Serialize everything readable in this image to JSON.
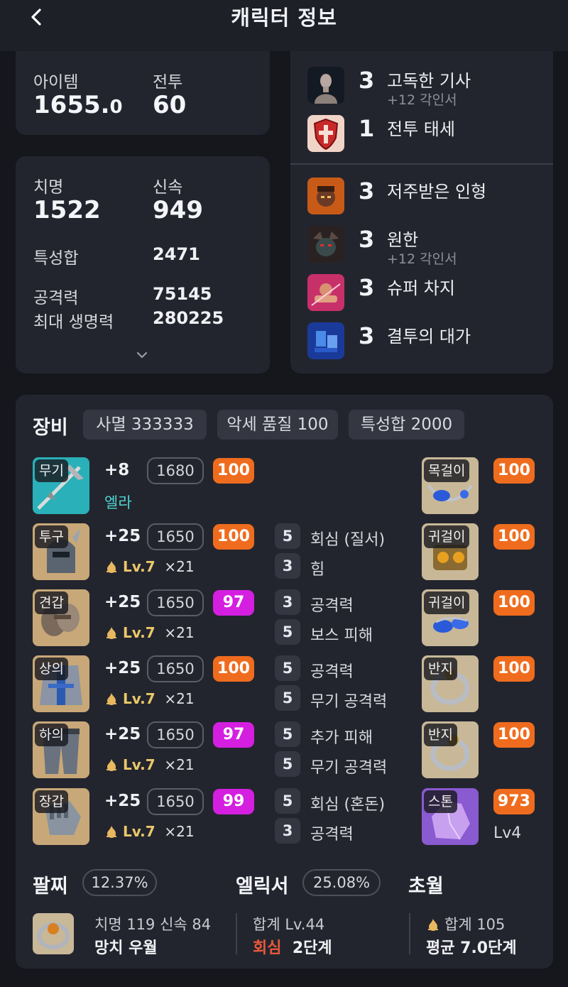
{
  "header": {
    "title": "캐릭터 정보"
  },
  "stats": {
    "item_label": "아이템",
    "item_level_int": "1655.",
    "item_level_dec": "0",
    "combat_label": "전투",
    "combat_level": "60",
    "crit_label": "치명",
    "crit_value": "1522",
    "swift_label": "신속",
    "swift_value": "949",
    "trait_sum_label": "특성합",
    "trait_sum_value": "2471",
    "attack_label": "공격력",
    "attack_value": "75145",
    "hp_label": "최대 생명력",
    "hp_value": "280225"
  },
  "engravings_top": [
    {
      "level": "3",
      "name": "고독한 기사",
      "sub": "+12 각인서",
      "icon": "lone-knight-icon"
    },
    {
      "level": "1",
      "name": "전투 태세",
      "sub": "",
      "icon": "combat-stance-icon"
    }
  ],
  "engravings_bottom": [
    {
      "level": "3",
      "name": "저주받은 인형",
      "sub": "",
      "icon": "cursed-doll-icon"
    },
    {
      "level": "3",
      "name": "원한",
      "sub": "+12 각인서",
      "icon": "grudge-icon"
    },
    {
      "level": "3",
      "name": "슈퍼 차지",
      "sub": "",
      "icon": "super-charge-icon"
    },
    {
      "level": "3",
      "name": "결투의 대가",
      "sub": "",
      "icon": "master-brawler-icon"
    }
  ],
  "equipment": {
    "title": "장비",
    "chips": [
      "사멸 333333",
      "악세 품질 100",
      "특성합 2000"
    ],
    "gear": [
      {
        "slot": "무기",
        "plus": "+8",
        "ilvl": "1680",
        "quality": "100",
        "qcolor": "#ef6c1e",
        "extra": "엘라"
      },
      {
        "slot": "투구",
        "plus": "+25",
        "ilvl": "1650",
        "quality": "100",
        "qcolor": "#ef6c1e",
        "tier": "Lv.7",
        "count": "×21",
        "elixirs": [
          {
            "lv": "5",
            "name": "회심 (질서)"
          },
          {
            "lv": "3",
            "name": "힘"
          }
        ]
      },
      {
        "slot": "견갑",
        "plus": "+25",
        "ilvl": "1650",
        "quality": "97",
        "qcolor": "#d41fe0",
        "tier": "Lv.7",
        "count": "×21",
        "elixirs": [
          {
            "lv": "3",
            "name": "공격력"
          },
          {
            "lv": "5",
            "name": "보스 피해"
          }
        ]
      },
      {
        "slot": "상의",
        "plus": "+25",
        "ilvl": "1650",
        "quality": "100",
        "qcolor": "#ef6c1e",
        "tier": "Lv.7",
        "count": "×21",
        "elixirs": [
          {
            "lv": "5",
            "name": "공격력"
          },
          {
            "lv": "5",
            "name": "무기 공격력"
          }
        ]
      },
      {
        "slot": "하의",
        "plus": "+25",
        "ilvl": "1650",
        "quality": "97",
        "qcolor": "#d41fe0",
        "tier": "Lv.7",
        "count": "×21",
        "elixirs": [
          {
            "lv": "5",
            "name": "추가 피해"
          },
          {
            "lv": "5",
            "name": "무기 공격력"
          }
        ]
      },
      {
        "slot": "장갑",
        "plus": "+25",
        "ilvl": "1650",
        "quality": "99",
        "qcolor": "#d41fe0",
        "tier": "Lv.7",
        "count": "×21",
        "elixirs": [
          {
            "lv": "5",
            "name": "회심 (혼돈)"
          },
          {
            "lv": "3",
            "name": "공격력"
          }
        ]
      }
    ],
    "accessories": [
      {
        "slot": "목걸이",
        "quality": "100"
      },
      {
        "slot": "귀걸이",
        "quality": "100"
      },
      {
        "slot": "귀걸이",
        "quality": "100"
      },
      {
        "slot": "반지",
        "quality": "100"
      },
      {
        "slot": "반지",
        "quality": "100"
      },
      {
        "slot": "스톤",
        "quality": "973",
        "level": "Lv4"
      }
    ]
  },
  "footer": {
    "bracelet_label": "팔찌",
    "bracelet_pct": "12.37%",
    "bracelet_stats": "치명 119  신속 84",
    "bracelet_effects": "망치  우월",
    "elixir_label": "엘릭서",
    "elixir_pct": "25.08%",
    "elixir_total": "합계 Lv.44",
    "elixir_effect_name": "회심",
    "elixir_effect_stage": "2단계",
    "transcend_label": "초월",
    "transcend_total": "합계 105",
    "transcend_avg": "평균 7.0단계"
  },
  "colors": {
    "quality_orange": "#ef6c1e",
    "quality_pink": "#d41fe0",
    "ella_cyan": "#4fd6d0",
    "elixir_red": "#e8593a",
    "tier_gold": "#e9c86a"
  }
}
